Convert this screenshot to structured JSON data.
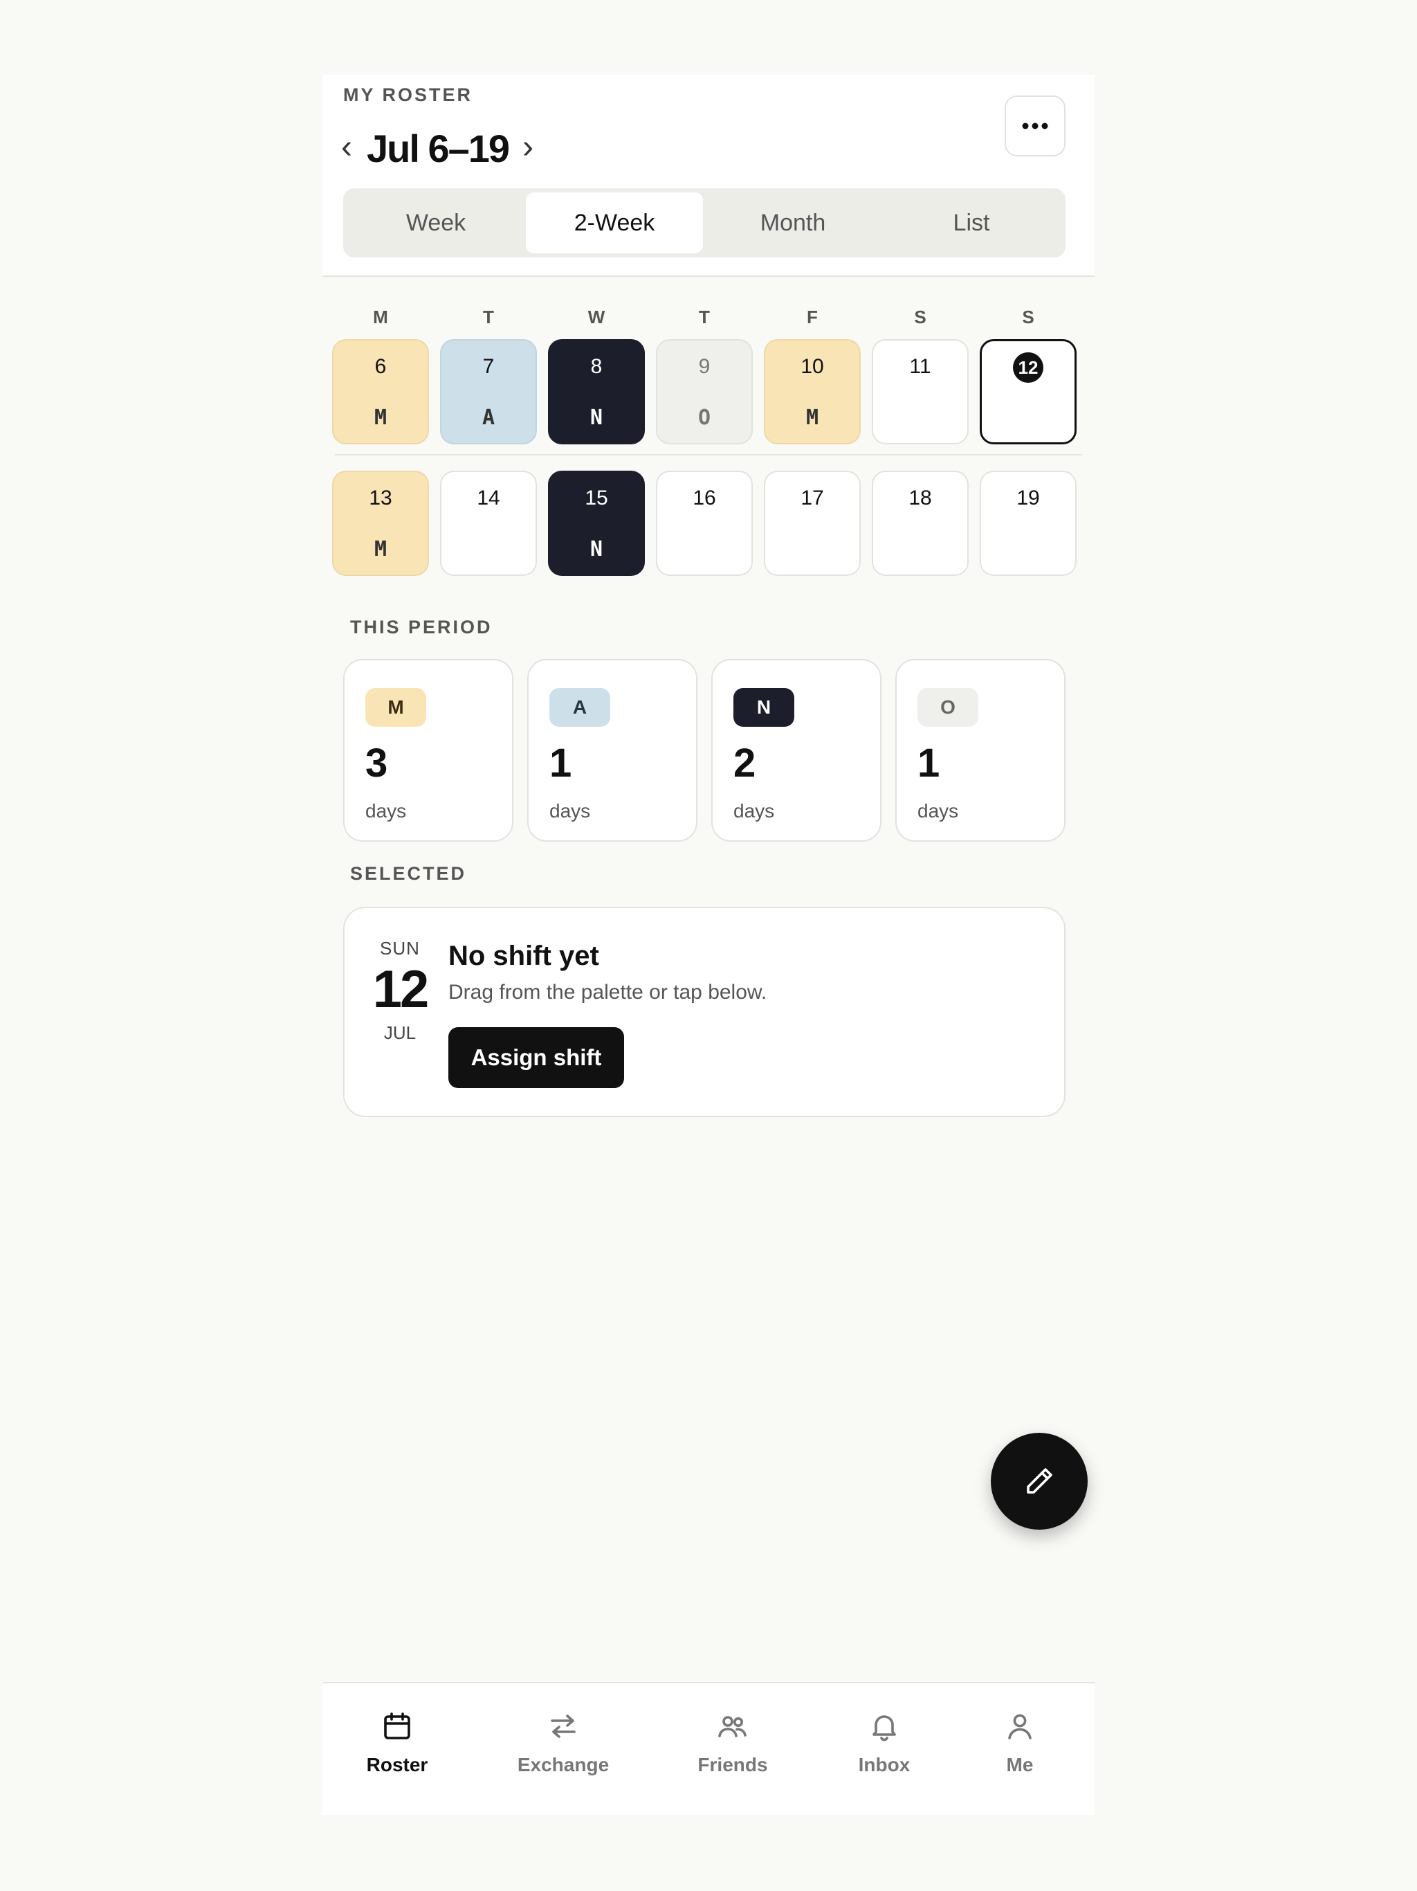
{
  "header": {
    "eyebrow": "MY ROSTER",
    "title": "Jul 6–19",
    "prev": "‹",
    "next": "›"
  },
  "view_tabs": [
    {
      "label": "Week",
      "active": false
    },
    {
      "label": "2-Week",
      "active": true
    },
    {
      "label": "Month",
      "active": false
    },
    {
      "label": "List",
      "active": false
    }
  ],
  "weekdays": [
    "M",
    "T",
    "W",
    "T",
    "F",
    "S",
    "S"
  ],
  "weeks": [
    [
      {
        "day": "6",
        "code": "M"
      },
      {
        "day": "7",
        "code": "A"
      },
      {
        "day": "8",
        "code": "N"
      },
      {
        "day": "9",
        "code": "O"
      },
      {
        "day": "10",
        "code": "M"
      },
      {
        "day": "11",
        "code": ""
      },
      {
        "day": "12",
        "code": "",
        "selected": true
      }
    ],
    [
      {
        "day": "13",
        "code": "M"
      },
      {
        "day": "14",
        "code": ""
      },
      {
        "day": "15",
        "code": "N"
      },
      {
        "day": "16",
        "code": ""
      },
      {
        "day": "17",
        "code": ""
      },
      {
        "day": "18",
        "code": ""
      },
      {
        "day": "19",
        "code": ""
      }
    ]
  ],
  "period": {
    "label": "THIS PERIOD",
    "stats": [
      {
        "code": "M",
        "count": "3",
        "unit": "days",
        "bg": "#f9e4b6",
        "fg": "#3a2e12"
      },
      {
        "code": "A",
        "count": "1",
        "unit": "days",
        "bg": "#cddfe9",
        "fg": "#243543"
      },
      {
        "code": "N",
        "count": "2",
        "unit": "days",
        "bg": "#1c1e2b",
        "fg": "#ffffff"
      },
      {
        "code": "O",
        "count": "1",
        "unit": "days",
        "bg": "#efefeb",
        "fg": "#666666"
      }
    ]
  },
  "selected": {
    "label": "SELECTED",
    "dow": "SUN",
    "day": "12",
    "month": "JUL",
    "title": "No shift yet",
    "subtitle": "Drag from the palette or tap below.",
    "button": "Assign shift"
  },
  "fab": {
    "icon": "pencil-icon"
  },
  "tabbar": [
    {
      "label": "Roster",
      "icon": "calendar-icon",
      "active": true
    },
    {
      "label": "Exchange",
      "icon": "swap-arrows-icon",
      "active": false
    },
    {
      "label": "Friends",
      "icon": "people-icon",
      "active": false
    },
    {
      "label": "Inbox",
      "icon": "bell-icon",
      "active": false
    },
    {
      "label": "Me",
      "icon": "person-icon",
      "active": false
    }
  ],
  "colors": {
    "morning": "#f9e4b6",
    "afternoon": "#cddfe9",
    "night": "#1c1e2b",
    "off": "#efefeb",
    "accent": "#111111"
  }
}
